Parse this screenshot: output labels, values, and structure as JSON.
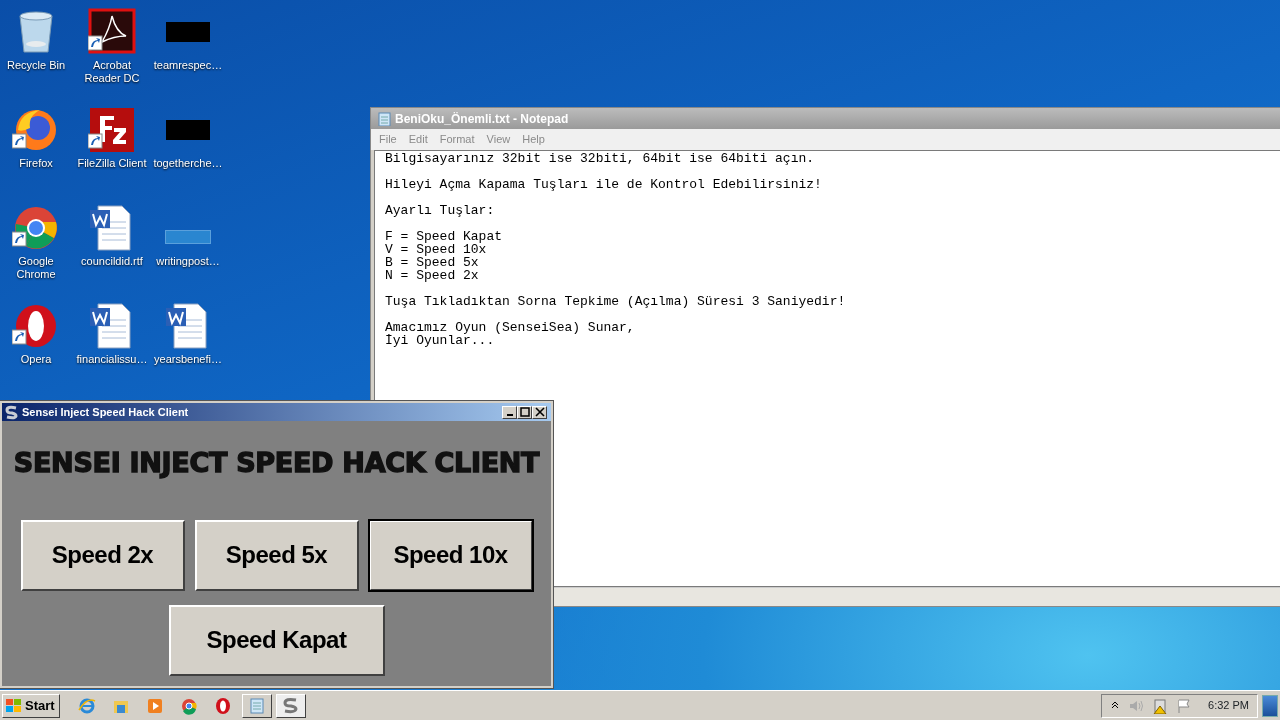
{
  "desktop_icons": [
    {
      "label": "Recycle Bin",
      "kind": "recycle",
      "shortcut": false
    },
    {
      "label": "Acrobat Reader DC",
      "kind": "acrobat",
      "shortcut": true
    },
    {
      "label": "teamrespec…",
      "kind": "redacted",
      "shortcut": false
    },
    {
      "label": "Firefox",
      "kind": "firefox",
      "shortcut": true
    },
    {
      "label": "FileZilla Client",
      "kind": "filezilla",
      "shortcut": true
    },
    {
      "label": "togetherche…",
      "kind": "redacted",
      "shortcut": false
    },
    {
      "label": "Google Chrome",
      "kind": "chrome",
      "shortcut": true
    },
    {
      "label": "councildid.rtf",
      "kind": "word",
      "shortcut": false
    },
    {
      "label": "writingpost…",
      "kind": "blank",
      "shortcut": false
    },
    {
      "label": "Opera",
      "kind": "opera",
      "shortcut": true
    },
    {
      "label": "financialissu…",
      "kind": "word",
      "shortcut": false
    },
    {
      "label": "yearsbenefi…",
      "kind": "word",
      "shortcut": false
    }
  ],
  "notepad": {
    "title": "BeniOku_Önemli.txt - Notepad",
    "menu": [
      "File",
      "Edit",
      "Format",
      "View",
      "Help"
    ],
    "paragraphs": [
      [
        "Bilgisayarınız 32bit ise 32biti, 64bit ise 64biti açın."
      ],
      [
        "Hileyi Açma Kapama Tuşları ile de Kontrol Edebilirsiniz!"
      ],
      [
        "Ayarlı Tuşlar:"
      ],
      [
        "F = Speed Kapat",
        "V = Speed 10x",
        "B = Speed 5x",
        "N = Speed 2x"
      ],
      [
        "Tuşa Tıkladıktan Sorna Tepkime (Açılma) Süresi 3 Saniyedir!"
      ],
      [
        "Amacımız Oyun (SenseiSea) Sunar,",
        "İyi Oyunlar..."
      ]
    ]
  },
  "hack_client": {
    "title": "Sensei Inject Speed Hack Client",
    "heading": "SENSEI INJECT SPEED HACK CLIENT",
    "buttons": [
      {
        "label": "Speed 2x",
        "focused": false
      },
      {
        "label": "Speed 5x",
        "focused": false
      },
      {
        "label": "Speed 10x",
        "focused": true
      },
      {
        "label": "Speed Kapat",
        "focused": false
      }
    ]
  },
  "taskbar": {
    "start": "Start",
    "items": [
      {
        "kind": "ie",
        "selected": false
      },
      {
        "kind": "explorer",
        "selected": false
      },
      {
        "kind": "media",
        "selected": false
      },
      {
        "kind": "chrome",
        "selected": false
      },
      {
        "kind": "opera",
        "selected": false
      },
      {
        "kind": "notepad",
        "selected": false
      },
      {
        "kind": "sensei",
        "selected": true
      }
    ],
    "clock": "6:32 PM"
  }
}
